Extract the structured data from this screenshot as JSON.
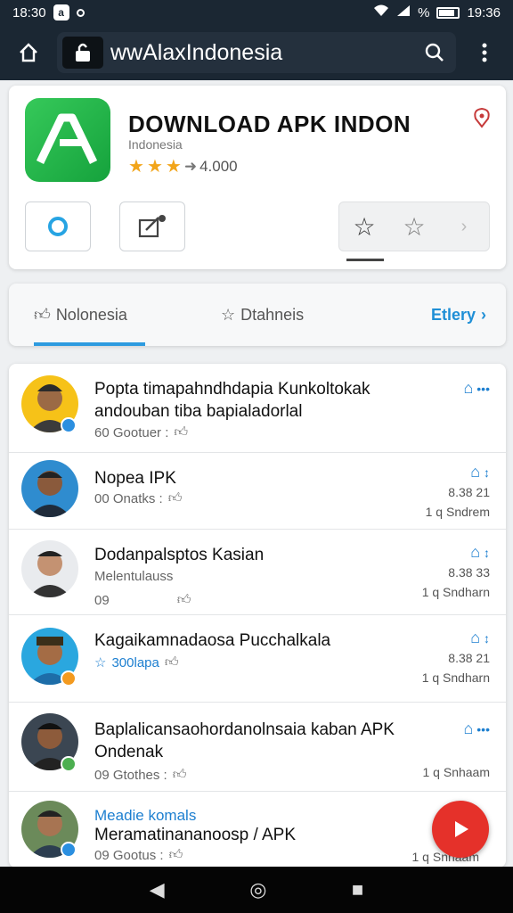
{
  "status_bar": {
    "time_left": "18:30",
    "notif_letter": "a",
    "battery": "%",
    "time_right": "19:36"
  },
  "browser": {
    "url": "wwAlaxIndonesia"
  },
  "app": {
    "title": "DOWNLOAD APK INDON",
    "subtitle": "Indonesia",
    "rating_text": "4.000",
    "icon_letter": "A"
  },
  "tabs": [
    {
      "label": "Nolonesia"
    },
    {
      "label": "Dtahneis"
    }
  ],
  "tabs_more": "Etlery",
  "items": [
    {
      "title": "Popta timapahndhdapia Kunkoltokak andouban tiba bapialadorlal",
      "meta": "60 Gootuer :",
      "right1": "",
      "right2": ""
    },
    {
      "title": "Nopea IPK",
      "meta": "00 Onatks :",
      "right1": "8.38 21",
      "right2": "1 q Sndrem"
    },
    {
      "title": "Dodanpalsptos Kasian",
      "subtitle": "Melentulauss",
      "meta": "09",
      "right1": "8.38 33",
      "right2": "1 q Sndharn"
    },
    {
      "title": "Kagaikamnadaosa Pucchalkala",
      "meta": "300lapa",
      "right1": "8.38 21",
      "right2": "1 q Sndharn"
    },
    {
      "title": "Baplalicansaohordanolnsaia kaban APK Ondenak",
      "meta": "09 Gtothes :",
      "right1": "",
      "right2": "1 q Snhaam"
    },
    {
      "title": "Meramatinananoosp / APK",
      "label": "Meadie komals",
      "meta": "09 Gootus :",
      "right1": "",
      "right2": "1 q Snhaam"
    }
  ]
}
